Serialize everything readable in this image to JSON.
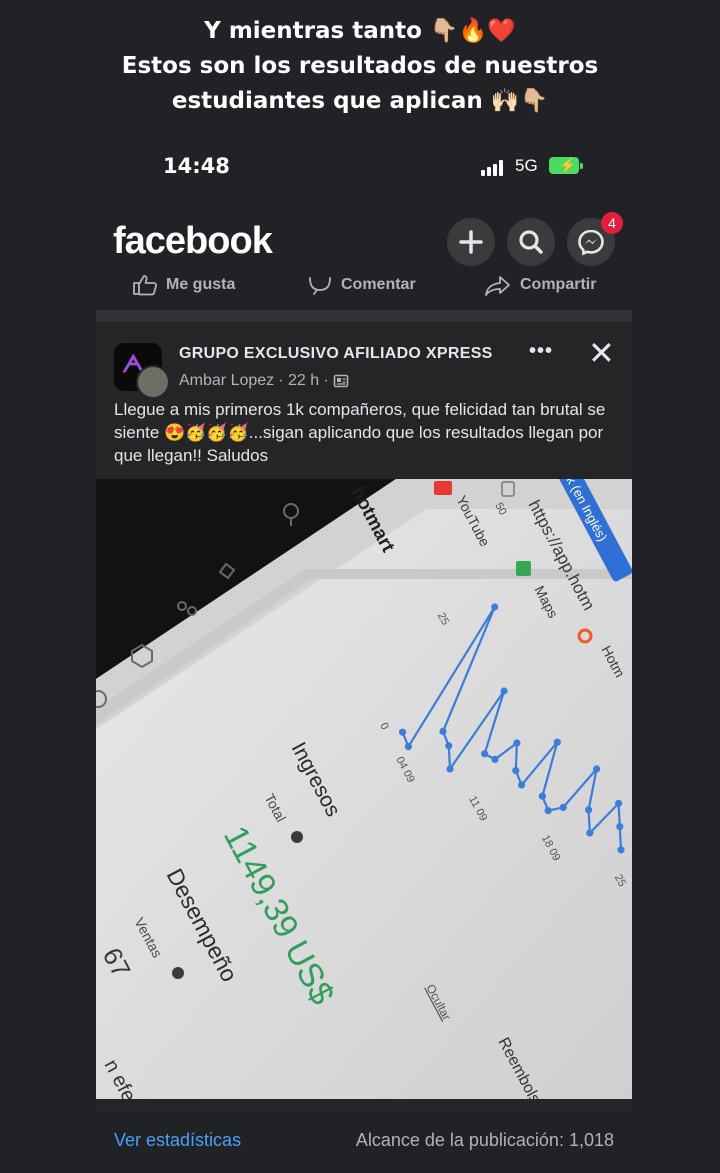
{
  "caption": {
    "line1": "Y mientras tanto 👇🏼🔥❤️",
    "line2": "Estos son los resultados de nuestros",
    "line3": "estudiantes que aplican 🙌🏻👇🏼"
  },
  "status_bar": {
    "time": "14:48",
    "network": "5G"
  },
  "facebook": {
    "logo": "facebook",
    "messenger_badge": "4",
    "actions": {
      "like": "Me gusta",
      "comment": "Comentar",
      "share": "Compartir"
    }
  },
  "post": {
    "group_name": "GRUPO EXCLUSIVO AFILIADO XPRESS",
    "author": "Ambar Lopez",
    "time": "· 22 h ·",
    "more": "•••",
    "close": "✕",
    "text": "Llegue a mis primeros 1k compañeros, que felicidad tan brutal se siente 😍🥳🥳🥳...sigan aplicando que los resultados llegan por que llegan!! Saludos"
  },
  "photo": {
    "brand": "hotmart",
    "url": "https://app.hotm",
    "lang_tag": "k (en Inglés)",
    "bookmarks": [
      "YouTube",
      "Maps",
      "Hotm"
    ],
    "ingresos_label": "Ingresos",
    "total_label": "Total",
    "total_value": "1149,39 US$",
    "desempeno_label": "Desempeño",
    "ventas_label": "Ventas",
    "ventas_value": "67",
    "ocultar": "Ocultar",
    "reembolsos": "Reembols",
    "bottom_text": "n efe",
    "y_ticks": [
      "0",
      "25",
      "50"
    ],
    "x_ticks": [
      "04 09",
      "11 09",
      "18 09",
      "25"
    ]
  },
  "chart_data": {
    "type": "line",
    "title": "Ingresos",
    "x": [
      "04 09",
      "",
      "",
      "",
      "",
      "",
      "",
      "11 09",
      "",
      "",
      "",
      "",
      "",
      "",
      "18 09",
      "",
      "",
      "",
      "",
      "",
      "",
      "25"
    ],
    "series": [
      {
        "values": [
          2,
          0,
          33,
          6,
          4,
          0,
          19,
          6,
          6,
          11,
          6,
          4,
          15,
          4,
          2,
          4,
          14,
          6,
          2,
          10,
          6,
          2
        ]
      }
    ],
    "ylim": [
      0,
      50
    ]
  },
  "footer": {
    "stats_link": "Ver estadísticas",
    "reach": "Alcance de la publicación: 1,018"
  },
  "colors": {
    "link": "#4b9ffb",
    "chart_line": "#3b7dd8",
    "money": "#2f9e5b"
  }
}
